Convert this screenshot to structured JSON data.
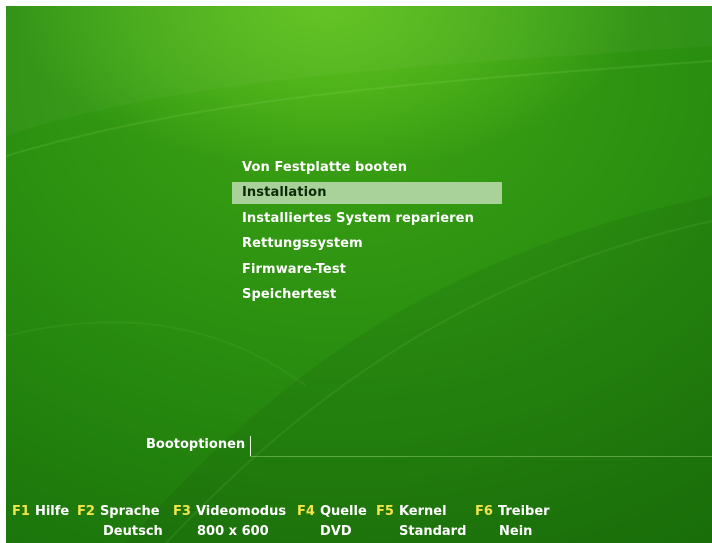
{
  "menu": {
    "items": [
      {
        "label": "Von Festplatte booten"
      },
      {
        "label": "Installation"
      },
      {
        "label": "Installiertes System reparieren"
      },
      {
        "label": "Rettungssystem"
      },
      {
        "label": "Firmware-Test"
      },
      {
        "label": "Speichertest"
      }
    ],
    "selected": "Installation"
  },
  "bootoptions": {
    "label": "Bootoptionen",
    "value": ""
  },
  "function_keys": [
    {
      "key": "F1",
      "label": "Hilfe",
      "value": ""
    },
    {
      "key": "F2",
      "label": "Sprache",
      "value": "Deutsch"
    },
    {
      "key": "F3",
      "label": "Videomodus",
      "value": "800 x 600"
    },
    {
      "key": "F4",
      "label": "Quelle",
      "value": "DVD"
    },
    {
      "key": "F5",
      "label": "Kernel",
      "value": "Standard"
    },
    {
      "key": "F6",
      "label": "Treiber",
      "value": "Nein"
    }
  ],
  "colors": {
    "background": "#2a8f10",
    "highlight": "#a9d29a",
    "function_key": "#f2e44a",
    "text": "#ffffff"
  }
}
